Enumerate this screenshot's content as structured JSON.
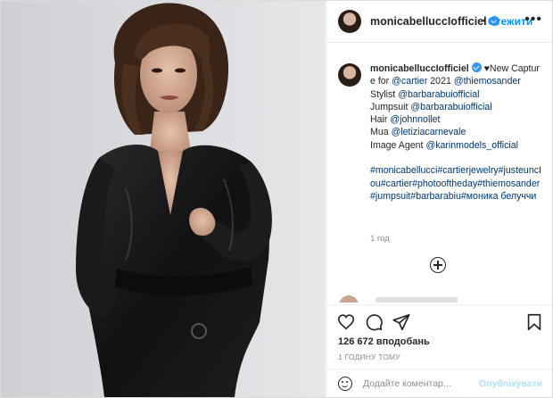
{
  "header": {
    "username": "monicabelluccIofficiel",
    "separator": "•",
    "follow_label": "Стежити",
    "more_icon": "more-horizontal-icon"
  },
  "caption": {
    "username": "monicabelluccIofficiel",
    "lines": [
      {
        "text": "♥New Capture for ",
        "type": "text"
      },
      {
        "text": "@cartier",
        "type": "link"
      },
      {
        "text": " 2021 ",
        "type": "text"
      },
      {
        "text": "@thiemosander",
        "type": "link"
      },
      {
        "text": "\nStylist ",
        "type": "text"
      },
      {
        "text": "@barbarabuiofficial",
        "type": "link"
      },
      {
        "text": "\nJumpsuit ",
        "type": "text"
      },
      {
        "text": "@barbarabuiofficial",
        "type": "link"
      },
      {
        "text": "\nHair ",
        "type": "text"
      },
      {
        "text": "@johnnollet",
        "type": "link"
      },
      {
        "text": "\nMua ",
        "type": "text"
      },
      {
        "text": "@letiziacarnevale",
        "type": "link"
      },
      {
        "text": "\nImage Agent ",
        "type": "text"
      },
      {
        "text": "@karinmodels_official",
        "type": "link"
      },
      {
        "text": "\n\n",
        "type": "text"
      },
      {
        "text": "#monicabellucci#cartierjewelry#justeuncIou#cartier#photooftheday#thiemosander#jumpsuit#barbarabiu#моника белуччи",
        "type": "link"
      }
    ],
    "time_ago": "1 год"
  },
  "actions": {
    "icons": [
      "heart-icon",
      "comment-icon",
      "share-icon",
      "bookmark-icon"
    ],
    "likes": "126 672 вподобань",
    "timestamp": "1 ГОДИНУ ТОМУ"
  },
  "comment": {
    "placeholder": "Додайте коментар...",
    "publish_label": "Опублікувати"
  },
  "colors": {
    "accent": "#0095f6",
    "verified": "#3897f0",
    "link": "#00376b",
    "muted": "#8e8e8e"
  }
}
